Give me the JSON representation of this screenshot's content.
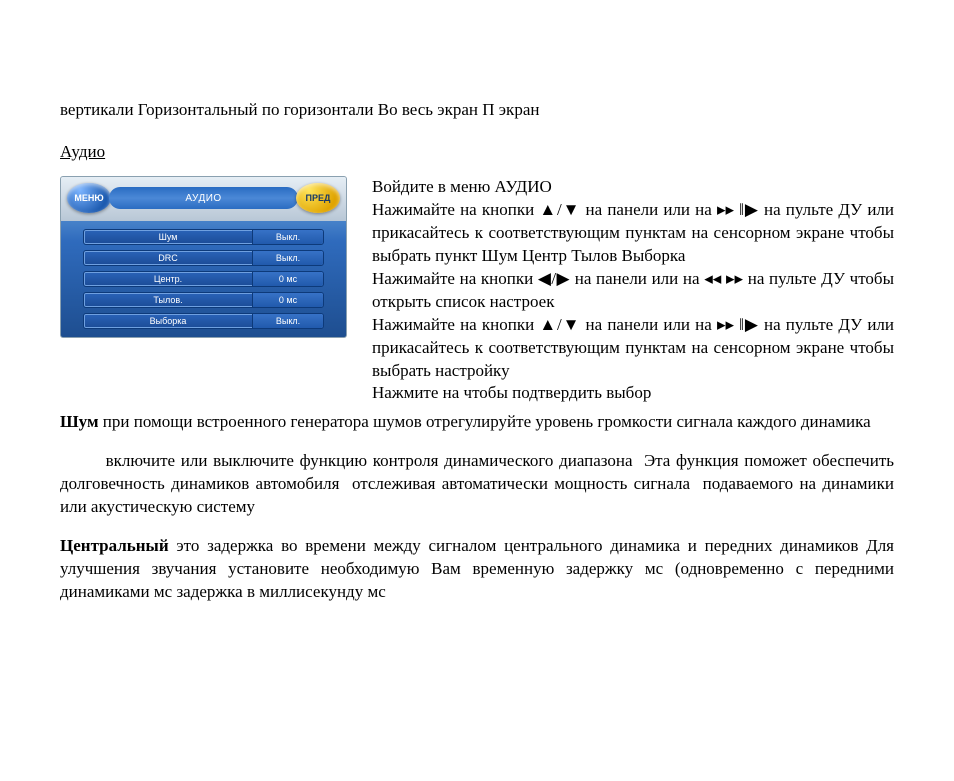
{
  "top_line": "вертикали   Горизонтальный   по горизонтали    Во весь экран  П  экран",
  "section_title": "Аудио",
  "menu": {
    "left_button": "МЕНЮ",
    "title": "АУДИО",
    "right_button": "ПРЕД",
    "rows": [
      {
        "label": "Шум",
        "value": "Выкл."
      },
      {
        "label": "DRC",
        "value": "Выкл."
      },
      {
        "label": "Центр.",
        "value": "0 мс"
      },
      {
        "label": "Тылов.",
        "value": "0 мс"
      },
      {
        "label": "Выборка",
        "value": "Выкл."
      }
    ]
  },
  "instr": {
    "p1": "Войдите в меню АУДИО",
    "p2": "Нажимайте на кнопки ▲/▼ на панели или на ▸▸ ‖▶ на пульте ДУ или прикасайтесь к соответствующим пунктам на сенсорном экране чтобы выбрать пункт Шум          Центр  Тылов   Выборка",
    "p3": "Нажимайте на кнопки ◀/▶ на панели или на ◂◂ ▸▸ на пульте ДУ чтобы открыть список настроек",
    "p4": "Нажимайте на кнопки ▲/▼ на панели или на ▸▸ ‖▶ на пульте ДУ или прикасайтесь к соответствующим пунктам на сенсорном экране  чтобы выбрать настройку",
    "p5": "Нажмите на                             чтобы подтвердить выбор"
  },
  "body": {
    "shum_label": "Шум",
    "shum_text": "  при помощи встроенного генератора шумов отрегулируйте уровень громкости сигнала каждого динамика",
    "drc_text": "        включите или выключите функцию контроля динамического диапазона  Эта функция поможет обеспечить долговечность динамиков автомобиля  отслеживая автоматически мощность сигнала  подаваемого на динамики или акустическую систему",
    "center_label": "Центральный",
    "center_text": "   это задержка во времени между сигналом центрального динамика и передних динамиков  Для улучшения звучания установите необходимую Вам временную задержку      мс (одновременно с передними динамиками      мс   задержка в    миллисекунду            мс"
  }
}
